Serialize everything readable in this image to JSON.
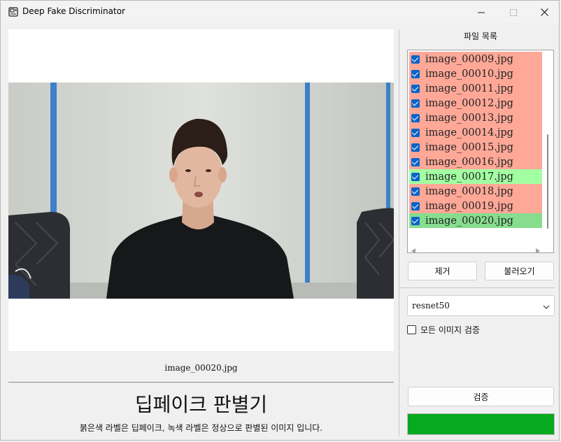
{
  "window": {
    "title": "Deep Fake Discriminator",
    "icon": "app-window-icon",
    "controls": [
      "minimize-icon",
      "maximize-icon",
      "close-icon"
    ]
  },
  "viewer": {
    "caption": "image_00020.jpg",
    "heading": "딥페이크 판별기",
    "description": "붉은색 라벨은 딥페이크, 녹색 라벨은 정상으로 판별된 이미지 입니다."
  },
  "file_list": {
    "title": "파일 목록",
    "items": [
      {
        "name": "image_00009.jpg",
        "checked": true,
        "color": "#ffa898"
      },
      {
        "name": "image_00010.jpg",
        "checked": true,
        "color": "#ffa898"
      },
      {
        "name": "image_00011.jpg",
        "checked": true,
        "color": "#ffa898"
      },
      {
        "name": "image_00012.jpg",
        "checked": true,
        "color": "#ffa898"
      },
      {
        "name": "image_00013.jpg",
        "checked": true,
        "color": "#ffa898"
      },
      {
        "name": "image_00014.jpg",
        "checked": true,
        "color": "#ffa898"
      },
      {
        "name": "image_00015.jpg",
        "checked": true,
        "color": "#ffa898"
      },
      {
        "name": "image_00016.jpg",
        "checked": true,
        "color": "#ffa898"
      },
      {
        "name": "image_00017.jpg",
        "checked": true,
        "color": "#a2ffa2"
      },
      {
        "name": "image_00018.jpg",
        "checked": true,
        "color": "#ffa898"
      },
      {
        "name": "image_00019.jpg",
        "checked": true,
        "color": "#ffa898"
      },
      {
        "name": "image_00020.jpg",
        "checked": true,
        "color": "#86dd8e"
      }
    ]
  },
  "buttons": {
    "remove": "제거",
    "load": "불러오기",
    "verify": "검증"
  },
  "model_select": {
    "value": "resnet50",
    "icon": "chevron-down-icon"
  },
  "verify_all": {
    "label": "모든 이미지 검증",
    "checked": false
  },
  "progress": {
    "value": 1.0,
    "color": "#06a91f"
  }
}
